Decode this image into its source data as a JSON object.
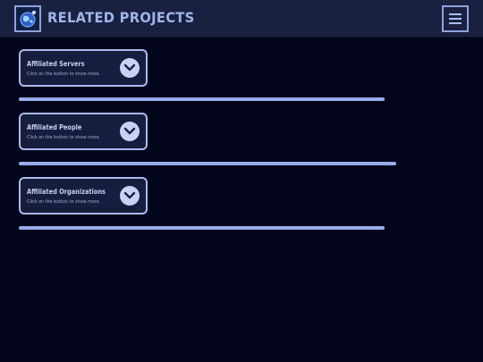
{
  "header": {
    "title": "RELATED PROJECTS",
    "logo_icon": "globe-logo-icon",
    "menu_icon": "hamburger-menu-icon"
  },
  "sections": [
    {
      "title": "Affiliated Servers",
      "subtitle": "Click on the button to show more.",
      "button_icon": "chevron-down-icon"
    },
    {
      "title": "Affiliated People",
      "subtitle": "Click on the button to show more.",
      "button_icon": "chevron-down-icon"
    },
    {
      "title": "Affiliated Organizations",
      "subtitle": "Click on the button to show more.",
      "button_icon": "chevron-down-icon"
    }
  ],
  "colors": {
    "background": "#03061a",
    "header": "#1a2140",
    "accent": "#98acec"
  }
}
